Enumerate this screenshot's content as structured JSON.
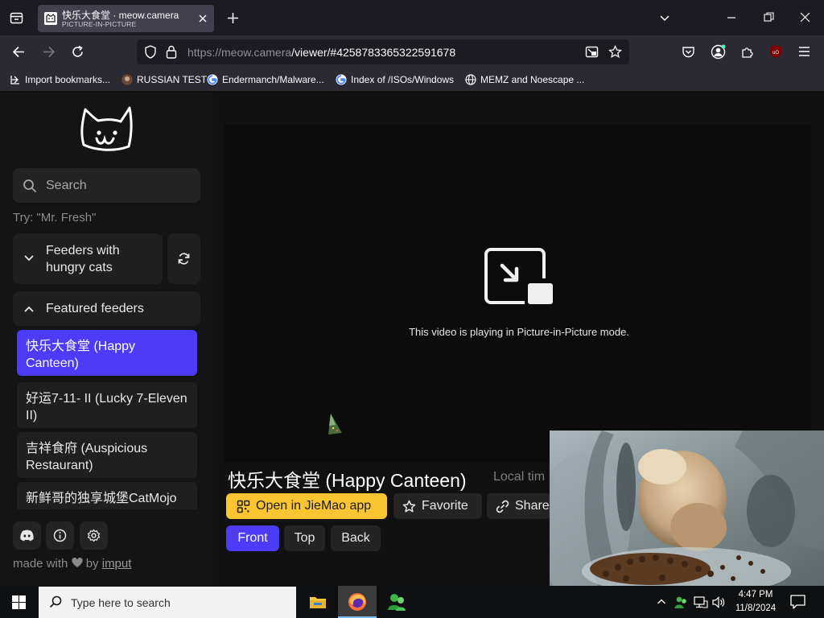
{
  "browser": {
    "tab": {
      "title": "快乐大食堂 · meow.camera",
      "subtitle": "PICTURE-IN-PICTURE"
    },
    "url": {
      "host": "https://meow.camera",
      "path": "/viewer/#4258783365322591678"
    },
    "bookmarks": [
      {
        "label": "Import bookmarks...",
        "icon": "import-icon"
      },
      {
        "label": "RUSSIAN TEST",
        "icon": "site-favicon"
      },
      {
        "label": "Endermanch/Malware...",
        "icon": "google-icon"
      },
      {
        "label": "Index of /ISOs/Windows",
        "icon": "google-icon"
      },
      {
        "label": "MEMZ and Noescape ...",
        "icon": "globe-icon"
      }
    ]
  },
  "sidebar": {
    "search_placeholder": "Search",
    "search_hint": "Try: \"Mr. Fresh\"",
    "hungry_section_label": "Feeders with hungry cats",
    "featured_section_label": "Featured feeders",
    "featured_feeders": [
      {
        "label": "快乐大食堂 (Happy Canteen)",
        "active": true
      },
      {
        "label": "好运7-11- II (Lucky 7-Eleven II)",
        "active": false
      },
      {
        "label": "吉祥食府 (Auspicious Restaurant)",
        "active": false
      },
      {
        "label": "新鲜哥的独享城堡CatMojo",
        "active": false
      }
    ],
    "footer_prefix": "made with",
    "footer_by": "by",
    "footer_link": "imput"
  },
  "viewer": {
    "pip_message": "This video is playing in Picture-in-Picture mode.",
    "feed_title": "快乐大食堂 (Happy Canteen)",
    "local_time_label": "Local tim",
    "actions": {
      "open_app": "Open in JieMao app",
      "favorite": "Favorite",
      "share": "Share"
    },
    "cameras": [
      "Front",
      "Top",
      "Back"
    ]
  },
  "taskbar": {
    "search_placeholder": "Type here to search",
    "time": "4:47 PM",
    "date": "11/8/2024"
  },
  "colors": {
    "accent": "#4d3bfa",
    "app_button": "#fbc531",
    "page_bg": "#111111"
  }
}
